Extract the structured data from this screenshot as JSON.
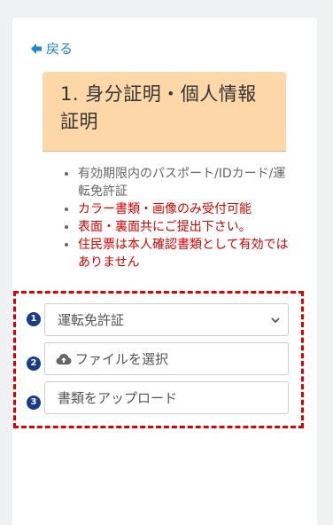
{
  "nav": {
    "back_label": "戻る"
  },
  "section": {
    "title": "1.  身分証明・個人情報証明"
  },
  "notes": [
    {
      "text": "有効期限内のパスポート/IDカード/運転免許証",
      "color": "gray"
    },
    {
      "text": "カラー書類・画像のみ受付可能",
      "color": "red"
    },
    {
      "text": "表面・裏面共にご提出下さい。",
      "color": "red"
    },
    {
      "text": "住民票は本人確認書類として有効ではありません",
      "color": "red"
    }
  ],
  "form": {
    "steps": [
      "1",
      "2",
      "3"
    ],
    "document_select": {
      "value": "運転免許証"
    },
    "file_button": {
      "label": "ファイルを選択",
      "icon": "cloud-upload-icon"
    },
    "upload_button": {
      "label": "書類をアップロード"
    }
  },
  "colors": {
    "accent_blue": "#1e88d6",
    "title_bg": "#fdd7a8",
    "warning_red": "#e00000",
    "step_badge": "#1a3a8a"
  }
}
